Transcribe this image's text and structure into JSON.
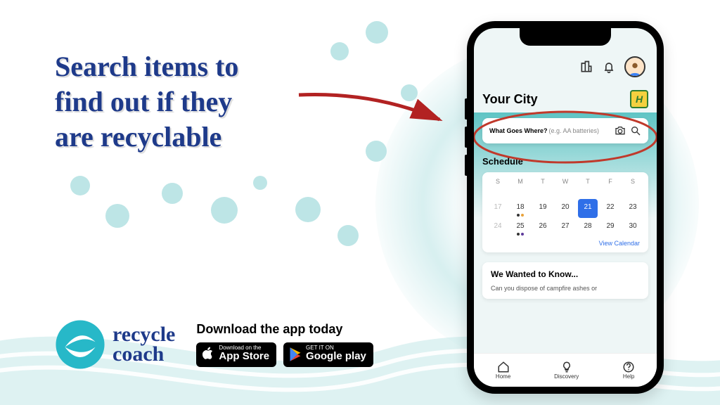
{
  "headline": "Search items to\nfind out if they\nare recyclable",
  "brand": {
    "line1": "recycle",
    "line2": "coach"
  },
  "download": {
    "text": "Download  the app today",
    "appstore": {
      "small": "Download on the",
      "big": "App Store"
    },
    "google": {
      "small": "GET IT ON",
      "big": "Google play"
    }
  },
  "app": {
    "city_label": "Your City",
    "search": {
      "label": "What Goes Where?",
      "hint": "(e.g. AA batteries)"
    },
    "schedule_label": "Schedule",
    "calendar": {
      "days": [
        "S",
        "M",
        "T",
        "W",
        "T",
        "F",
        "S"
      ],
      "weeks": [
        [
          {
            "n": "",
            "muted": true
          },
          {
            "n": "",
            "muted": true
          },
          {
            "n": "",
            "muted": true
          },
          {
            "n": "",
            "muted": true
          },
          {
            "n": "",
            "muted": true
          },
          {
            "n": "",
            "muted": true
          },
          {
            "n": "",
            "muted": true
          }
        ],
        [
          {
            "n": "17",
            "muted": true
          },
          {
            "n": "18",
            "dots": [
              "dark",
              "orange"
            ]
          },
          {
            "n": "19"
          },
          {
            "n": "20"
          },
          {
            "n": "21",
            "today": true
          },
          {
            "n": "22"
          },
          {
            "n": "23"
          }
        ],
        [
          {
            "n": "24",
            "muted": true
          },
          {
            "n": "25",
            "dots": [
              "dark",
              "purple"
            ]
          },
          {
            "n": "26"
          },
          {
            "n": "27"
          },
          {
            "n": "28"
          },
          {
            "n": "29"
          },
          {
            "n": "30"
          }
        ]
      ],
      "link": "View Calendar"
    },
    "info": {
      "title": "We Wanted to Know...",
      "body": "Can you dispose of campfire ashes or"
    },
    "nav": {
      "home": "Home",
      "discovery": "Discovery",
      "help": "Help"
    }
  }
}
